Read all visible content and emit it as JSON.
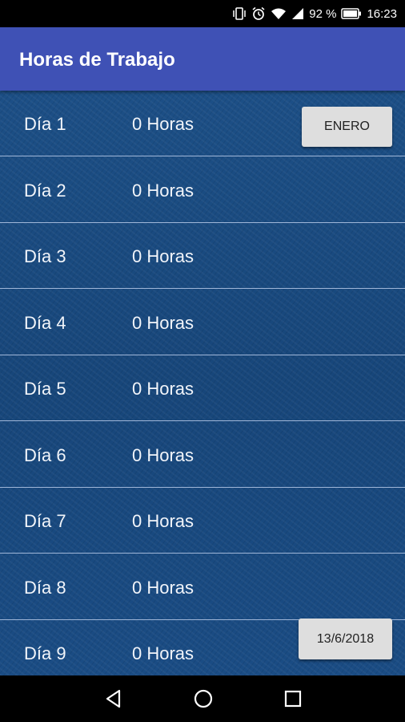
{
  "status_bar": {
    "battery_percent": "92 %",
    "time": "16:23"
  },
  "app_bar": {
    "title": "Horas de Trabajo"
  },
  "rows": [
    {
      "day": "Día 1",
      "hours": "0 Horas"
    },
    {
      "day": "Día 2",
      "hours": "0 Horas"
    },
    {
      "day": "Día 3",
      "hours": "0 Horas"
    },
    {
      "day": "Día 4",
      "hours": "0 Horas"
    },
    {
      "day": "Día 5",
      "hours": "0 Horas"
    },
    {
      "day": "Día 6",
      "hours": "0 Horas"
    },
    {
      "day": "Día 7",
      "hours": "0 Horas"
    },
    {
      "day": "Día 8",
      "hours": "0 Horas"
    },
    {
      "day": "Día 9",
      "hours": "0 Horas"
    }
  ],
  "month_button": {
    "label": "ENERO"
  },
  "date_button": {
    "label": "13/6/2018"
  },
  "colors": {
    "app_bar": "#3f51b5",
    "background": "#1a4a80"
  },
  "icons": [
    "vibrate-icon",
    "alarm-icon",
    "wifi-icon",
    "signal-icon",
    "battery-icon",
    "back-icon",
    "home-icon",
    "recents-icon"
  ]
}
